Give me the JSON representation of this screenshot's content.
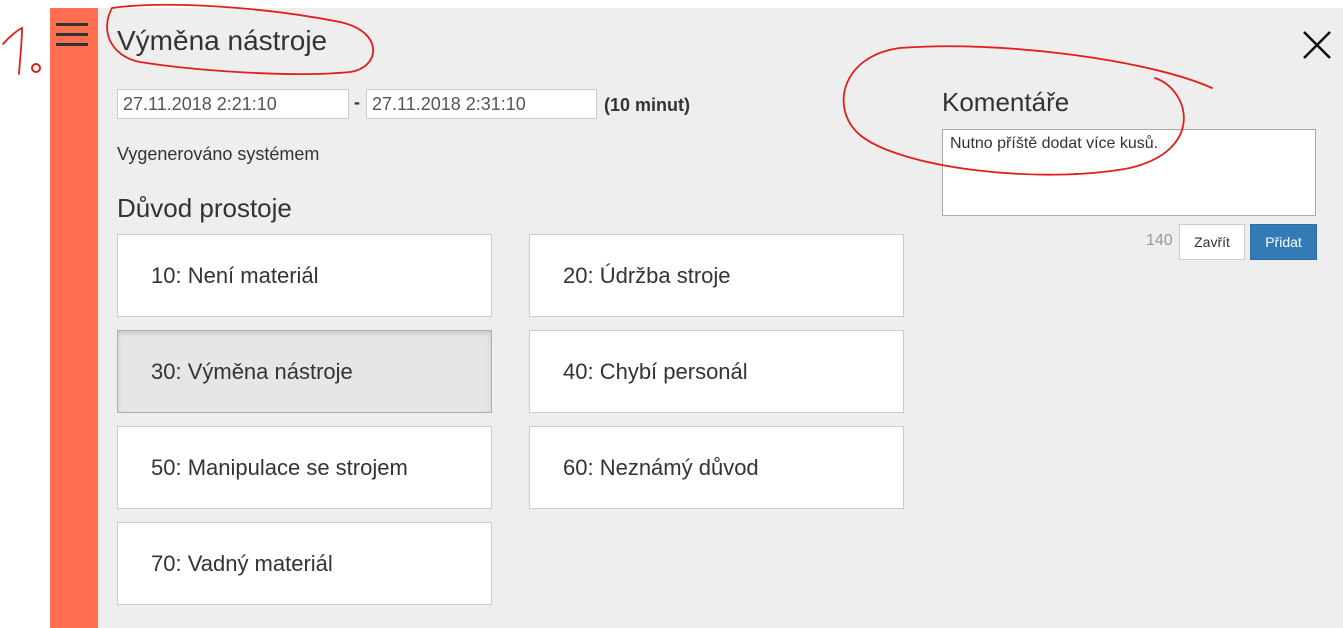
{
  "header": {
    "title": "Výměna nástroje",
    "menu_icon": "hamburger-menu-icon",
    "close_icon": "close-icon"
  },
  "annotation": {
    "marker": "1."
  },
  "timespan": {
    "start": "27.11.2018 2:21:10",
    "separator": "-",
    "end": "27.11.2018 2:31:10",
    "duration": "(10 minut)"
  },
  "generated_note": "Vygenerováno systémem",
  "reasons": {
    "title": "Důvod prostoje",
    "items": [
      {
        "label": "10: Není materiál",
        "selected": false
      },
      {
        "label": "20: Údržba stroje",
        "selected": false
      },
      {
        "label": "30: Výměna nástroje",
        "selected": true
      },
      {
        "label": "40: Chybí personál",
        "selected": false
      },
      {
        "label": "50: Manipulace se strojem",
        "selected": false
      },
      {
        "label": "60: Neznámý důvod",
        "selected": false
      },
      {
        "label": "70: Vadný materiál",
        "selected": false
      }
    ]
  },
  "comments": {
    "title": "Komentáře",
    "text": "Nutno příště dodat více kusů.",
    "char_count": "140",
    "close_label": "Zavřít",
    "add_label": "Přidat"
  },
  "colors": {
    "accent_bar": "#ff6f50",
    "panel_bg": "#eeeeee",
    "primary_button": "#337ab7",
    "annotation_red": "#e0201c"
  }
}
